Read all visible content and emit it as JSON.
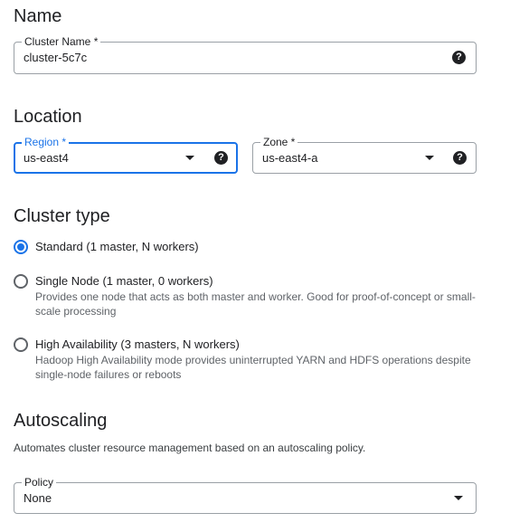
{
  "name_section": {
    "heading": "Name",
    "cluster_name_label": "Cluster Name *",
    "cluster_name_value": "cluster-5c7c"
  },
  "location_section": {
    "heading": "Location",
    "region_label": "Region *",
    "region_value": "us-east4",
    "zone_label": "Zone *",
    "zone_value": "us-east4-a"
  },
  "cluster_type_section": {
    "heading": "Cluster type",
    "options": [
      {
        "label": "Standard (1 master, N workers)",
        "description": "",
        "selected": true
      },
      {
        "label": "Single Node (1 master, 0 workers)",
        "description": "Provides one node that acts as both master and worker. Good for proof-of-concept or small-scale processing",
        "selected": false
      },
      {
        "label": "High Availability (3 masters, N workers)",
        "description": "Hadoop High Availability mode provides uninterrupted YARN and HDFS operations despite single-node failures or reboots",
        "selected": false
      }
    ]
  },
  "autoscaling_section": {
    "heading": "Autoscaling",
    "description": "Automates cluster resource management based on an autoscaling policy.",
    "policy_label": "Policy",
    "policy_value": "None"
  },
  "help_icon_glyph": "?",
  "colors": {
    "accent": "#1a73e8",
    "text": "#202124",
    "secondary_text": "#5f6368",
    "border": "#9aa0a6"
  }
}
